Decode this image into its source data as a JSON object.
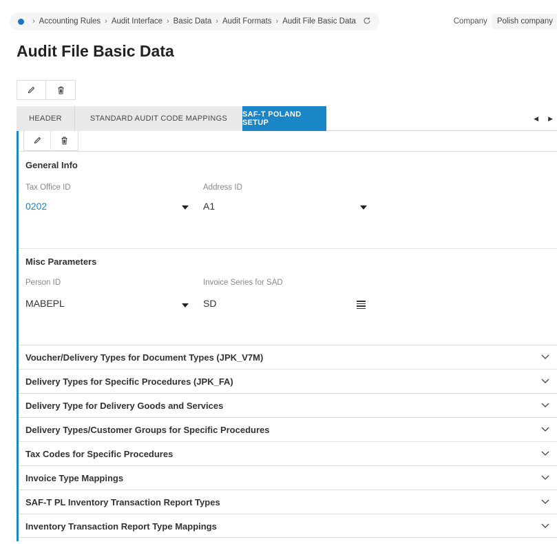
{
  "breadcrumb": {
    "items": [
      "Accounting Rules",
      "Audit Interface",
      "Basic Data",
      "Audit Formats",
      "Audit File Basic Data"
    ]
  },
  "company": {
    "label": "Company",
    "value": "Polish company"
  },
  "page": {
    "title": "Audit File Basic Data"
  },
  "tabs": [
    {
      "label": "HEADER"
    },
    {
      "label": "STANDARD AUDIT CODE MAPPINGS"
    },
    {
      "label": "SAF-T POLAND SETUP"
    }
  ],
  "general_info": {
    "title": "General Info",
    "tax_office": {
      "label": "Tax Office ID",
      "value": "0202"
    },
    "address": {
      "label": "Address ID",
      "value": "A1"
    }
  },
  "misc": {
    "title": "Misc Parameters",
    "person": {
      "label": "Person ID",
      "value": "MABEPL"
    },
    "invoice_series": {
      "label": "Invoice Series for SAD",
      "value": "SD"
    }
  },
  "accordions": [
    {
      "label": "Voucher/Delivery Types for Document Types (JPK_V7M)"
    },
    {
      "label": "Delivery Types for Specific Procedures (JPK_FA)"
    },
    {
      "label": "Delivery Type for Delivery Goods and Services"
    },
    {
      "label": "Delivery Types/Customer Groups for Specific Procedures"
    },
    {
      "label": "Tax Codes for Specific Procedures"
    },
    {
      "label": "Invoice Type Mappings"
    },
    {
      "label": "SAF-T PL Inventory Transaction Report Types"
    },
    {
      "label": "Inventory Transaction Report Type Mappings"
    }
  ],
  "colors": {
    "accent": "#1a86c8",
    "tab_inactive": "#e9e9e9"
  }
}
